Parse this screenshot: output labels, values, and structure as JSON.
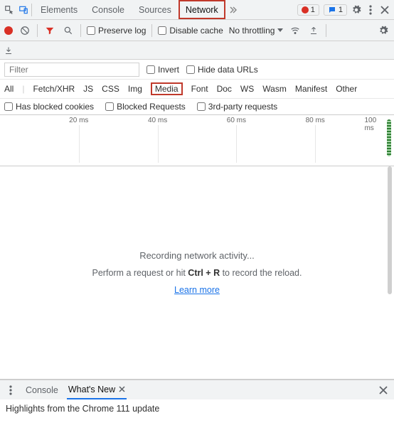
{
  "topTabs": {
    "elements": "Elements",
    "console": "Console",
    "sources": "Sources",
    "network": "Network"
  },
  "counts": {
    "errors": "1",
    "messages": "1"
  },
  "toolbar": {
    "preserveLog": "Preserve log",
    "disableCache": "Disable cache",
    "throttling": "No throttling"
  },
  "filter": {
    "placeholder": "Filter",
    "invert": "Invert",
    "hideDataUrls": "Hide data URLs"
  },
  "types": {
    "all": "All",
    "fetch": "Fetch/XHR",
    "js": "JS",
    "css": "CSS",
    "img": "Img",
    "media": "Media",
    "font": "Font",
    "doc": "Doc",
    "ws": "WS",
    "wasm": "Wasm",
    "manifest": "Manifest",
    "other": "Other"
  },
  "extraFilters": {
    "blockedCookies": "Has blocked cookies",
    "blockedRequests": "Blocked Requests",
    "thirdParty": "3rd-party requests"
  },
  "timeline": {
    "ticks": [
      "20 ms",
      "40 ms",
      "60 ms",
      "80 ms",
      "100 ms"
    ]
  },
  "empty": {
    "recording": "Recording network activity...",
    "hintPrefix": "Perform a request or hit ",
    "shortcut": "Ctrl + R",
    "hintSuffix": " to record the reload.",
    "learnMore": "Learn more"
  },
  "drawer": {
    "console": "Console",
    "whatsNew": "What's New",
    "headline": "Highlights from the Chrome 111 update"
  }
}
